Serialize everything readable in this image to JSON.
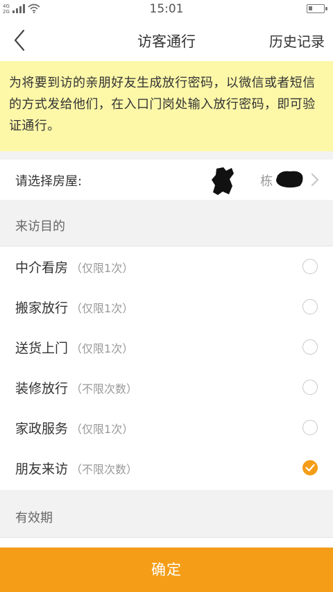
{
  "status_bar": {
    "network_top": "4G",
    "network_bottom": "2G",
    "time": "15:01",
    "battery_level": 0.28,
    "signal_icon": "signal-bars-icon",
    "wifi_icon": "wifi-icon",
    "battery_icon": "battery-icon"
  },
  "nav": {
    "back_icon": "back-chevron-icon",
    "title": "访客通行",
    "history_label": "历史记录"
  },
  "notice": {
    "text": "为将要到访的亲朋好友生成放行密码，以微信或者短信的方式发给他们，在入口门岗处输入放行密码，即可验证通行。",
    "background": "#fdf8a8"
  },
  "house": {
    "label": "请选择房屋:",
    "value": "栋 - 10",
    "chevron_icon": "chevron-right-icon"
  },
  "purpose": {
    "section_title": "来访目的",
    "items": [
      {
        "name": "中介看房",
        "limit": "（仅限1次）",
        "selected": false
      },
      {
        "name": "搬家放行",
        "limit": "（仅限1次）",
        "selected": false
      },
      {
        "name": "送货上门",
        "limit": "（仅限1次）",
        "selected": false
      },
      {
        "name": "装修放行",
        "limit": "（不限次数）",
        "selected": false
      },
      {
        "name": "家政服务",
        "limit": "（仅限1次）",
        "selected": false
      },
      {
        "name": "朋友来访",
        "limit": "（不限次数）",
        "selected": true
      }
    ],
    "radio_icon": "radio-icon",
    "check_icon": "check-icon"
  },
  "validity": {
    "section_title": "有效期"
  },
  "confirm": {
    "label": "确定",
    "color": "#f59d17"
  },
  "colors": {
    "accent": "#f59d17",
    "page_background": "#f2f2f2"
  }
}
